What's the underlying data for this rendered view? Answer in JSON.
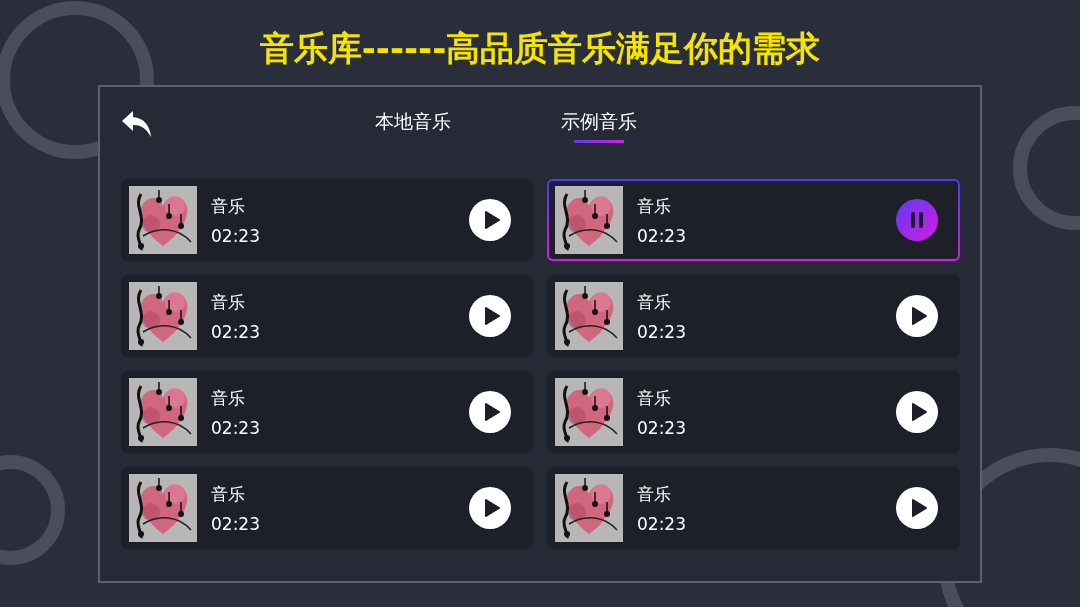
{
  "headline": "音乐库------高品质音乐满足你的需求",
  "tabs": [
    {
      "label": "本地音乐",
      "selected": false
    },
    {
      "label": "示例音乐",
      "selected": true
    }
  ],
  "tracks": [
    {
      "title": "音乐",
      "duration": "02:23",
      "playing": false
    },
    {
      "title": "音乐",
      "duration": "02:23",
      "playing": true
    },
    {
      "title": "音乐",
      "duration": "02:23",
      "playing": false
    },
    {
      "title": "音乐",
      "duration": "02:23",
      "playing": false
    },
    {
      "title": "音乐",
      "duration": "02:23",
      "playing": false
    },
    {
      "title": "音乐",
      "duration": "02:23",
      "playing": false
    },
    {
      "title": "音乐",
      "duration": "02:23",
      "playing": false
    },
    {
      "title": "音乐",
      "duration": "02:23",
      "playing": false
    }
  ]
}
